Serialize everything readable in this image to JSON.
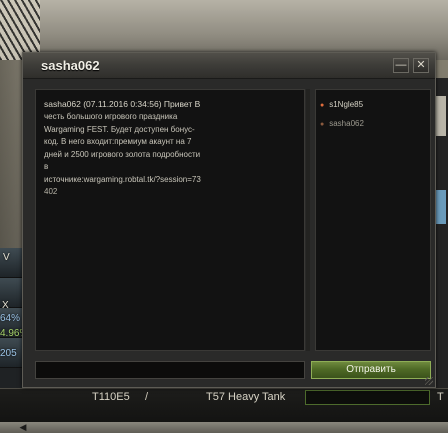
{
  "window": {
    "title": "sasha062",
    "minimize_glyph": "—",
    "close_glyph": "✕"
  },
  "chat": {
    "message_header": "sasha062 (07.11.2016 0:34:56) Привет В",
    "message_lines": [
      "честь большого игрового праздника",
      "Wargaming FEST. Будет доступен бонус-",
      "код. В него входит:премиум акаунт на 7",
      "дней и 2500 игрового золота подробности",
      "в",
      "источнике:wargaming.robtal.tk/?session=73",
      "402"
    ]
  },
  "members": [
    {
      "name": "s1Ngle85",
      "online": true
    },
    {
      "name": "sasha062",
      "online": false
    }
  ],
  "input": {
    "value": "",
    "placeholder": ""
  },
  "send_button": {
    "label": "Отправить"
  },
  "background": {
    "carousel_tank": "T110E5",
    "carousel_class": "T57 Heavy Tank",
    "carousel_right_letter": "T",
    "side_labels": [
      "V",
      "X",
      "64%",
      "4.96%",
      "205",
      "x"
    ]
  },
  "colors": {
    "send_button": "#4f6a26",
    "online_dot": "#e06c3c",
    "window_bg": "#2a2a29"
  }
}
